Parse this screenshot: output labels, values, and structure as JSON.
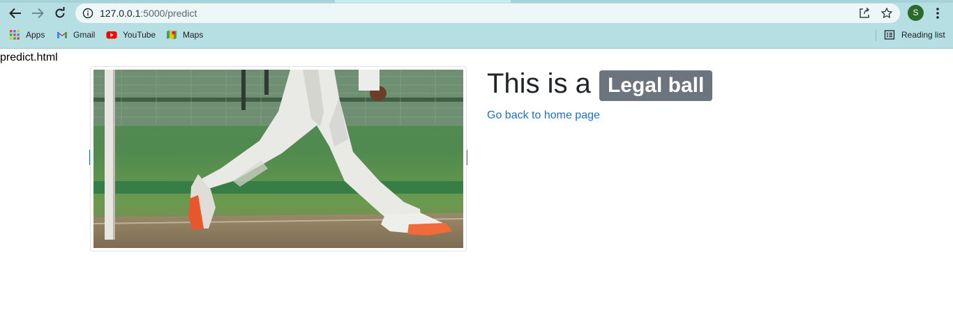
{
  "browser": {
    "url_host": "127.0.0.1",
    "url_path": ":5000/predict",
    "avatar_initial": "S",
    "bookmarks": [
      {
        "label": "Apps",
        "icon": "apps-grid-icon"
      },
      {
        "label": "Gmail",
        "icon": "gmail-icon"
      },
      {
        "label": "YouTube",
        "icon": "youtube-icon"
      },
      {
        "label": "Maps",
        "icon": "maps-icon"
      }
    ],
    "reading_list": "Reading list"
  },
  "page": {
    "file_label": "predict.html",
    "image_alt": "cricket bowler front foot at popping crease",
    "heading_prefix": "This is a",
    "verdict": "Legal ball",
    "back_link": "Go back to home page"
  },
  "colors": {
    "chrome_bg": "#b6dfe4",
    "badge_bg": "#6c757d",
    "link": "#1a6fd0",
    "avatar_bg": "#2b6a2a"
  }
}
